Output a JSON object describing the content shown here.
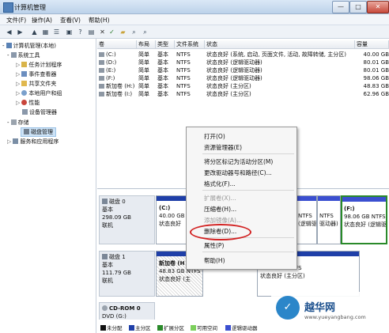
{
  "window": {
    "title": "计算机管理",
    "btn_min": "—",
    "btn_max": "□",
    "btn_close": "✕"
  },
  "menu": [
    "文件(F)",
    "操作(A)",
    "查看(V)",
    "帮助(H)"
  ],
  "toolbar_icons": [
    "back-icon",
    "forward-icon",
    "up-icon",
    "show-hide-tree-icon",
    "properties-icon",
    "help-icon",
    "delete-icon",
    "check-icon",
    "folder-open-icon",
    "search-icon",
    "magnifier-icon"
  ],
  "tree": [
    {
      "label": "计算机管理(本地)",
      "level": 0,
      "expander": "-"
    },
    {
      "label": "系统工具",
      "level": 1,
      "expander": "-"
    },
    {
      "label": "任务计划程序",
      "level": 2,
      "expander": "▷"
    },
    {
      "label": "事件查看器",
      "level": 2,
      "expander": "▷"
    },
    {
      "label": "共享文件夹",
      "level": 2,
      "expander": "▷"
    },
    {
      "label": "本地用户和组",
      "level": 2,
      "expander": "▷"
    },
    {
      "label": "性能",
      "level": 2,
      "expander": "▷"
    },
    {
      "label": "设备管理器",
      "level": 2,
      "expander": ""
    },
    {
      "label": "存储",
      "level": 1,
      "expander": "-"
    },
    {
      "label": "磁盘管理",
      "level": 2,
      "expander": "",
      "selected": true
    },
    {
      "label": "服务和应用程序",
      "level": 1,
      "expander": "▷"
    }
  ],
  "volume_table": {
    "headers": [
      "卷",
      "布局",
      "类型",
      "文件系统",
      "状态",
      "容量"
    ],
    "rows": [
      [
        "(C:)",
        "简单",
        "基本",
        "NTFS",
        "状态良好 (系统, 启动, 页面文件, 活动, 故障转储, 主分区)",
        "40.00 GB"
      ],
      [
        "(D:)",
        "简单",
        "基本",
        "NTFS",
        "状态良好 (逻辑驱动器)",
        "80.01 GB"
      ],
      [
        "(E:)",
        "简单",
        "基本",
        "NTFS",
        "状态良好 (逻辑驱动器)",
        "80.01 GB"
      ],
      [
        "(F:)",
        "简单",
        "基本",
        "NTFS",
        "状态良好 (逻辑驱动器)",
        "98.06 GB"
      ],
      [
        "新加卷 (H:)",
        "简单",
        "基本",
        "NTFS",
        "状态良好 (主分区)",
        "48.83 GB"
      ],
      [
        "新加卷 (I:)",
        "简单",
        "基本",
        "NTFS",
        "状态良好 (主分区)",
        "62.96 GB"
      ]
    ]
  },
  "disks": [
    {
      "name": "磁盘 0",
      "type": "基本",
      "size": "298.09 GB",
      "status": "联机"
    },
    {
      "name": "磁盘 1",
      "type": "基本",
      "size": "111.79 GB",
      "status": "联机"
    },
    {
      "name": "CD-ROM 0",
      "type": "DVD (G:)",
      "size": "",
      "status": ""
    }
  ],
  "partitions": {
    "c": {
      "name": "(C:)",
      "size": "40.00 GB",
      "status": "状态良好"
    },
    "d_right": {
      "size": "NTFS",
      "status": "(逻辑驱动器)"
    },
    "e_right": {
      "size": "NTFS",
      "status": "驱动器)"
    },
    "f": {
      "name": "(F:)",
      "size": "98.06 GB NTFS",
      "status": "状态良好 (逻辑驱动器)"
    },
    "h": {
      "name": "新加卷 (H",
      "size": "48.83 GB NTFS",
      "status": "状态良好 (主"
    },
    "i_tail": {
      "size": "62.96 GB NTFS",
      "status": "状态良好 (主分区)"
    }
  },
  "context_menu": [
    {
      "label": "打开(O)",
      "disabled": false
    },
    {
      "label": "资源管理器(E)",
      "disabled": false
    },
    {
      "sep": true
    },
    {
      "label": "将分区标记为活动分区(M)",
      "disabled": false
    },
    {
      "label": "更改驱动器号和路径(C)...",
      "disabled": false
    },
    {
      "label": "格式化(F)...",
      "disabled": false
    },
    {
      "sep": true
    },
    {
      "label": "扩展卷(X)...",
      "disabled": true
    },
    {
      "label": "压缩卷(H)...",
      "disabled": false
    },
    {
      "label": "添加镜像(A)...",
      "disabled": true
    },
    {
      "label": "删除卷(D)...",
      "disabled": false
    },
    {
      "sep": true
    },
    {
      "label": "属性(P)",
      "disabled": false
    },
    {
      "sep": true
    },
    {
      "label": "帮助(H)",
      "disabled": false
    }
  ],
  "legend": [
    {
      "label": "未分配",
      "color": "#111111"
    },
    {
      "label": "主分区",
      "color": "#1f3fa8"
    },
    {
      "label": "扩展分区",
      "color": "#2a8a2a"
    },
    {
      "label": "可用空间",
      "color": "#7ccf5c"
    },
    {
      "label": "逻辑驱动器",
      "color": "#3b4fd0"
    }
  ],
  "colors": {
    "primary_partition": "#1f3fa8",
    "logical_drive": "#3b4fd0",
    "extended_partition": "#2a8a2a",
    "context_highlight": "#d22222"
  },
  "watermark": {
    "name": "越华网",
    "url": "www.yueyangbang.com",
    "logo": "✓"
  }
}
